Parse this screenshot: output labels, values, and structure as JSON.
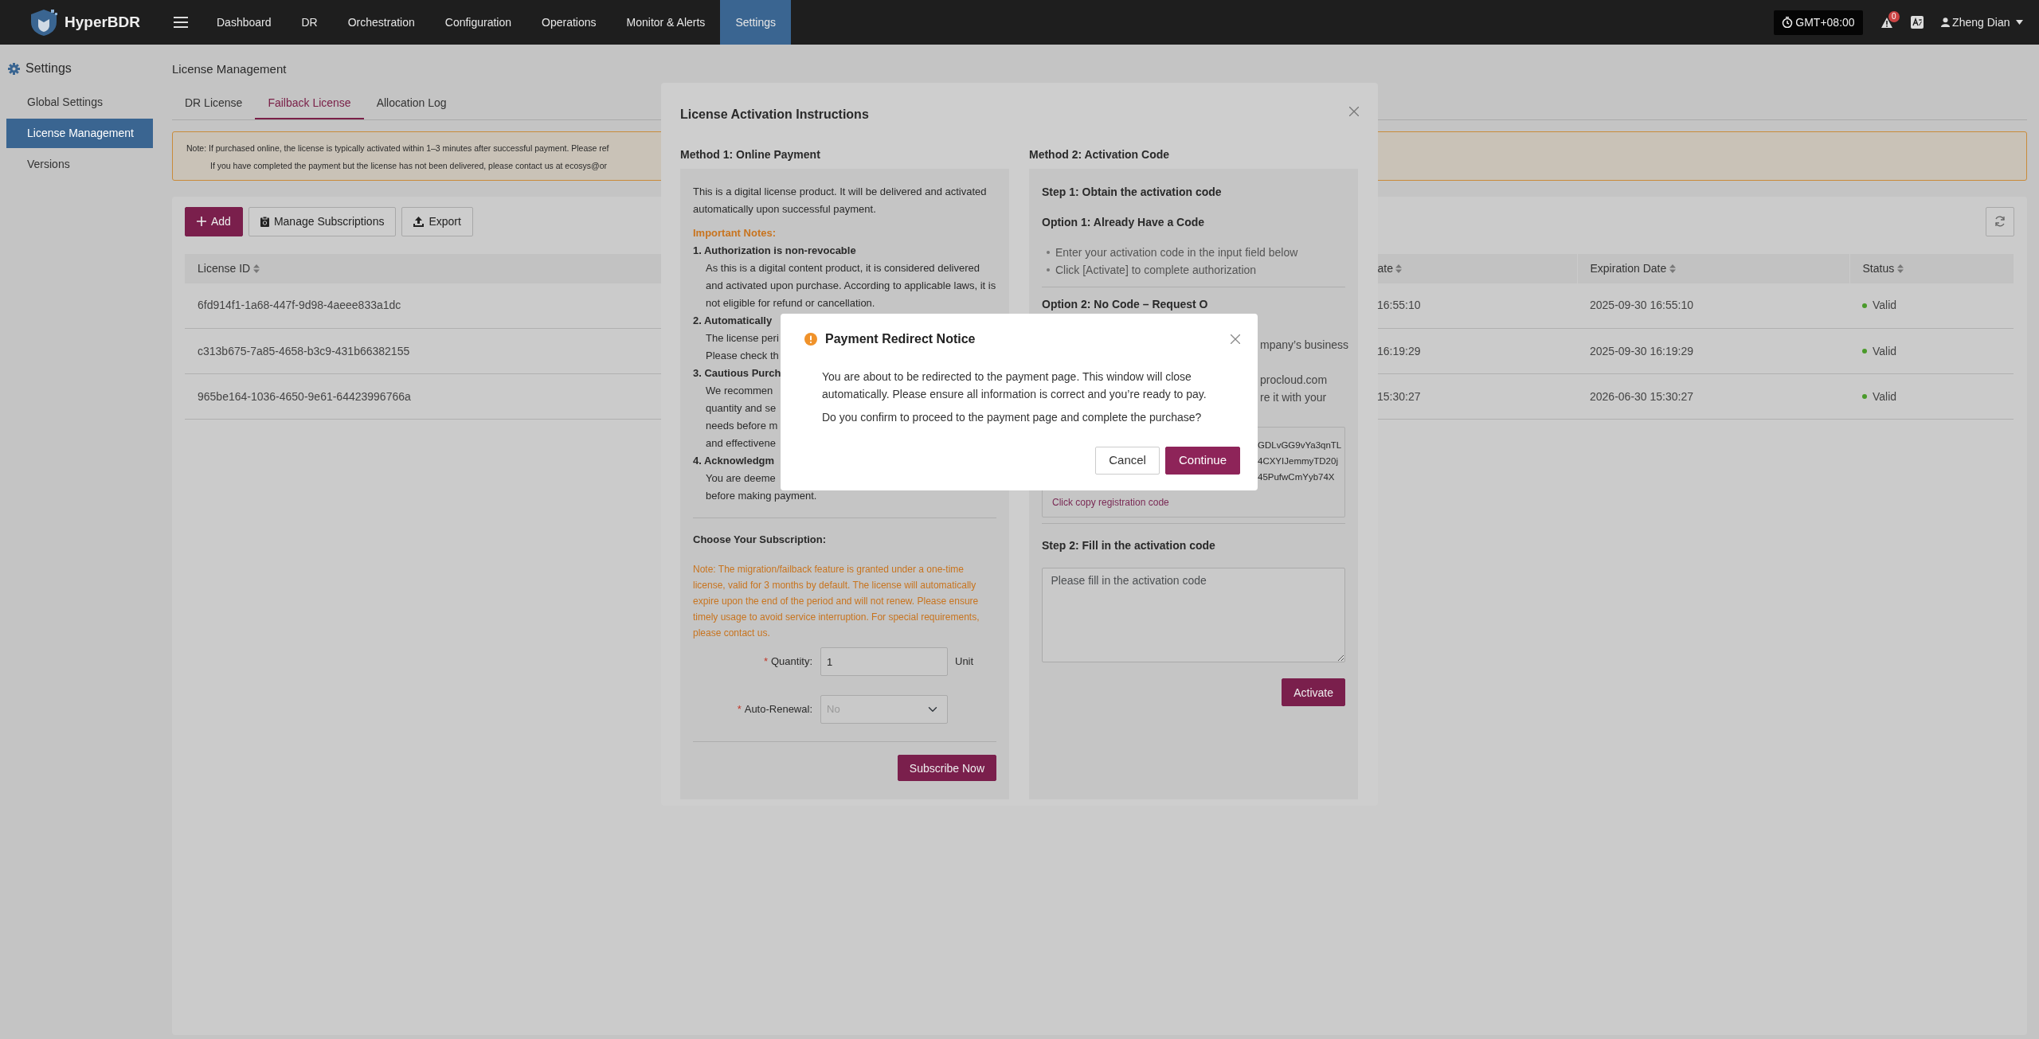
{
  "navbar": {
    "brand": "HyperBDR",
    "menu": [
      {
        "label": "Dashboard",
        "selected": false
      },
      {
        "label": "DR",
        "selected": false
      },
      {
        "label": "Orchestration",
        "selected": false
      },
      {
        "label": "Configuration",
        "selected": false
      },
      {
        "label": "Operations",
        "selected": false
      },
      {
        "label": "Monitor & Alerts",
        "selected": false
      },
      {
        "label": "Settings",
        "selected": true
      }
    ],
    "timezone": "GMT+08:00",
    "alert_count": "0",
    "user": "Zheng Dian"
  },
  "sidebar": {
    "title": "Settings",
    "items": [
      {
        "label": "Global Settings",
        "selected": false
      },
      {
        "label": "License Management",
        "selected": true
      },
      {
        "label": "Versions",
        "selected": false
      }
    ]
  },
  "page": {
    "title": "License Management",
    "tabs": [
      {
        "label": "DR License",
        "selected": false
      },
      {
        "label": "Failback License",
        "selected": true
      },
      {
        "label": "Allocation Log",
        "selected": false
      }
    ],
    "notice": [
      "Note: If purchased online, the license is typically activated within 1–3 minutes after successful payment. Please ref",
      "If you have completed the payment but the license has not been delivered, please contact us at ecosys@or"
    ],
    "toolbar": [
      {
        "label": "Add",
        "kind": "add"
      },
      {
        "label": "Manage Subscriptions",
        "kind": "subscriptions"
      },
      {
        "label": "Export",
        "kind": "export"
      }
    ],
    "table": {
      "columns": [
        "License ID",
        "ate",
        "Expiration Date",
        "Status"
      ],
      "rows": [
        {
          "cells": [
            "6fd914f1-1a68-447f-9d98-4aeee833a1dc",
            "16:55:10",
            "2025-09-30 16:55:10",
            "Valid"
          ]
        },
        {
          "cells": [
            "c313b675-7a85-4658-b3c9-431b66382155",
            "16:19:29",
            "2025-09-30 16:19:29",
            "Valid"
          ]
        },
        {
          "cells": [
            "965be164-1036-4650-9e61-64423996766a",
            "15:30:27",
            "2026-06-30 15:30:27",
            "Valid"
          ]
        }
      ]
    }
  },
  "activation_modal": {
    "title": "License Activation Instructions",
    "method1": {
      "heading": "Method 1: Online Payment",
      "intro": "This is a digital license product. It will be delivered and activated automatically upon successful payment.",
      "notes_title": "Important Notes:",
      "notes": [
        {
          "title": "1. Authorization is non-revocable",
          "lines": [
            "As this is a digital content product, it is considered delivered and activated upon purchase. According to applicable laws, it is not eligible for refund or cancellation."
          ]
        },
        {
          "title": "2. Automatically",
          "lines": [
            "The license peri",
            "Please check th"
          ]
        },
        {
          "title": "3. Cautious Purch",
          "lines": [
            "We recommen",
            "quantity and se",
            "needs before m",
            "and effectivene"
          ]
        },
        {
          "title": "4. Acknowledgm",
          "lines": [
            "You are deeme",
            "before making payment."
          ]
        }
      ],
      "subscription_title": "Choose Your Subscription:",
      "subscription_note": "Note: The migration/failback feature is granted under a one-time license, valid for 3 months by default. The license will automatically expire upon the end of the period and will not renew. Please ensure timely usage to avoid service interruption. For special requirements, please contact us.",
      "quantity": {
        "required_mark": "*",
        "label": "Quantity:",
        "value": "1",
        "unit": "Unit"
      },
      "auto_renewal": {
        "required_mark": "*",
        "label": "Auto-Renewal:",
        "value": "No",
        "disabled": true
      },
      "subscribe_label": "Subscribe Now"
    },
    "method2": {
      "heading": "Method 2: Activation Code",
      "step1_title": "Step 1: Obtain the activation code",
      "option1_title": "Option 1: Already Have a Code",
      "option1_bullets": [
        "Enter your activation code in the input field below",
        "Click [Activate] to complete authorization"
      ],
      "option2_title": "Option 2: No Code – Request O",
      "option2_fragments": [
        "mpany’s business",
        "procloud.com",
        "re it with your"
      ],
      "code_fragments": [
        "GDLvGG9vYa3qnTL",
        "4CXYIJemmyTD20j",
        "45PufwCmYyb74X"
      ],
      "copy_link": "Click copy registration code",
      "step2_title": "Step 2: Fill in the activation code",
      "code_placeholder": "Please fill in the activation code",
      "activate_label": "Activate"
    }
  },
  "confirm_dialog": {
    "title": "Payment Redirect Notice",
    "message": "You are about to be redirected to the payment page. This window will close automatically. Please ensure all information is correct and you’re ready to pay.",
    "question": "Do you confirm to proceed to the payment page and complete the purchase?",
    "buttons": [
      {
        "label": "Cancel",
        "kind": "secondary"
      },
      {
        "label": "Continue",
        "kind": "primary"
      }
    ]
  }
}
